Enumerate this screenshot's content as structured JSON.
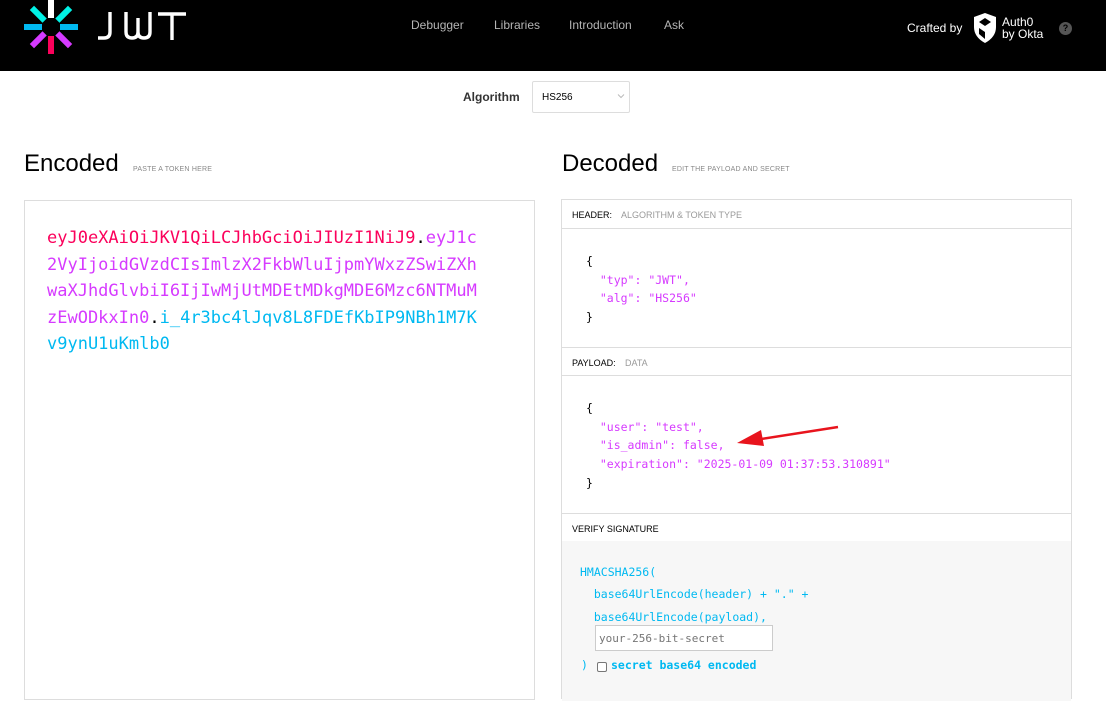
{
  "nav": {
    "logo_text": "JWT",
    "links": [
      "Debugger",
      "Libraries",
      "Introduction",
      "Ask"
    ],
    "crafted_by": "Crafted by",
    "auth0_line1": "Auth0",
    "auth0_line2": "by Okta",
    "help": "?"
  },
  "algorithm": {
    "label": "Algorithm",
    "value": "HS256"
  },
  "encoded": {
    "title": "Encoded",
    "subtitle": "PASTE A TOKEN HERE",
    "header": "eyJ0eXAiOiJKV1QiLCJhbGciOiJIUzI1NiJ9",
    "payload": "eyJ1c2VyIjoidGVzdCIsImlzX2FkbWluIjpmYWxzZSwiZXhwaXJhdGlvbiI6IjIwMjUtMDEtMDkgMDE6Mzc6NTMuMzEwODkxIn0",
    "signature": "i_4r3bc4lJqv8L8FDEfKbIP9NBh1M7Kv9ynU1uKmlb0",
    "dot": "."
  },
  "decoded": {
    "title": "Decoded",
    "subtitle": "EDIT THE PAYLOAD AND SECRET",
    "header_section": {
      "key": "HEADER:",
      "desc": "ALGORITHM & TOKEN TYPE"
    },
    "header_json": {
      "open": "{",
      "line1_key": "\"typ\"",
      "line1_rest": ": \"JWT\",",
      "line2_key": "\"alg\"",
      "line2_rest": ": \"HS256\"",
      "close": "}"
    },
    "payload_section": {
      "key": "PAYLOAD:",
      "desc": "DATA"
    },
    "payload_json": {
      "open": "{",
      "line1_key": "\"user\"",
      "line1_rest": ": \"test\",",
      "line2_key": "\"is_admin\"",
      "line2_rest": ": false,",
      "line3_key": "\"expiration\"",
      "line3_rest": ": \"2025-01-09 01:37:53.310891\"",
      "close": "}"
    },
    "verify_section": {
      "key": "VERIFY SIGNATURE"
    },
    "verify": {
      "line1": "HMACSHA256(",
      "line2": "  base64UrlEncode(header) + \".\" +",
      "line3": "  base64UrlEncode(payload),",
      "secret_placeholder": "your-256-bit-secret",
      "close": ")",
      "checkbox_label": "secret base64 encoded"
    }
  },
  "colors": {
    "header": "#fb015b",
    "payload": "#d63aff",
    "signature": "#00b9f1",
    "arrow": "#e8141d"
  }
}
